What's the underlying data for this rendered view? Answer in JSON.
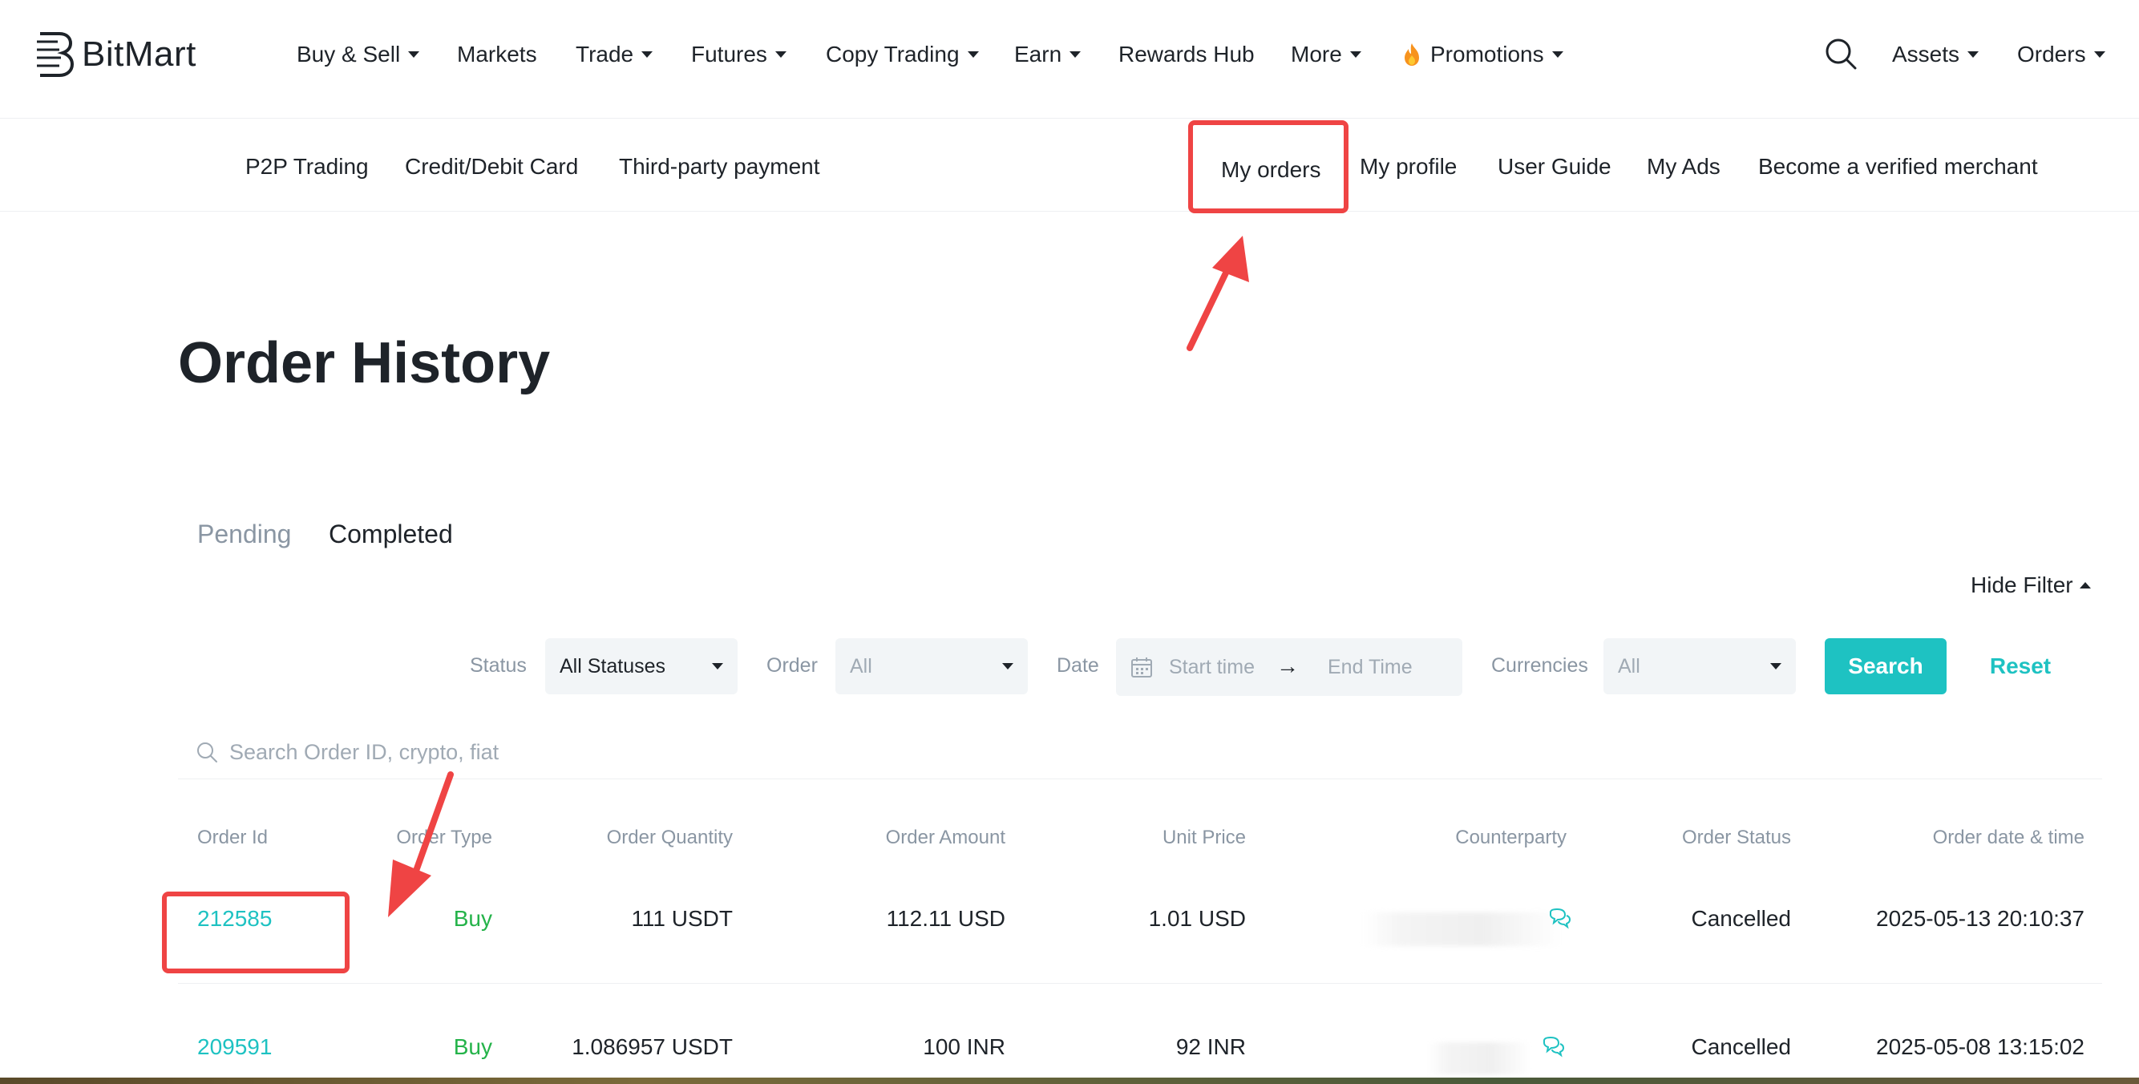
{
  "brand": {
    "name": "BitMart"
  },
  "topnav": {
    "items": [
      {
        "label": "Buy & Sell",
        "caret": true
      },
      {
        "label": "Markets",
        "caret": false
      },
      {
        "label": "Trade",
        "caret": true
      },
      {
        "label": "Futures",
        "caret": true
      },
      {
        "label": "Copy Trading",
        "caret": true
      },
      {
        "label": "Earn",
        "caret": true
      },
      {
        "label": "Rewards Hub",
        "caret": false
      },
      {
        "label": "More",
        "caret": true
      },
      {
        "label": "Promotions",
        "caret": true
      }
    ],
    "right": {
      "search_icon": "search-icon",
      "assets": "Assets",
      "orders": "Orders"
    }
  },
  "subnav": {
    "left": [
      "P2P Trading",
      "Credit/Debit Card",
      "Third-party payment"
    ],
    "right": [
      "My orders",
      "My profile",
      "User Guide",
      "My Ads",
      "Become a verified merchant"
    ]
  },
  "page": {
    "title": "Order History",
    "tabs": [
      "Pending",
      "Completed"
    ],
    "active_tab": "Completed",
    "hide_filter": "Hide Filter"
  },
  "filters": {
    "status_label": "Status",
    "status_value": "All Statuses",
    "order_label": "Order",
    "order_value": "All",
    "date_label": "Date",
    "date_start_placeholder": "Start time",
    "date_end_placeholder": "End Time",
    "currencies_label": "Currencies",
    "currencies_value": "All",
    "search_button": "Search",
    "reset_button": "Reset"
  },
  "order_search": {
    "placeholder": "Search Order ID, crypto, fiat"
  },
  "table": {
    "headers": [
      "Order Id",
      "Order Type",
      "Order Quantity",
      "Order Amount",
      "Unit Price",
      "Counterparty",
      "Order Status",
      "Order date & time"
    ],
    "rows": [
      {
        "order_id": "212585",
        "type": "Buy",
        "quantity": "111 USDT",
        "amount": "112.11 USD",
        "unit_price": "1.01 USD",
        "counterparty": "",
        "status": "Cancelled",
        "datetime": "2025-05-13 20:10:37"
      },
      {
        "order_id": "209591",
        "type": "Buy",
        "quantity": "1.086957 USDT",
        "amount": "100 INR",
        "unit_price": "92 INR",
        "counterparty": "",
        "status": "Cancelled",
        "datetime": "2025-05-08 13:15:02"
      }
    ]
  },
  "colors": {
    "accent": "#1ec2c2",
    "buy": "#25b34a",
    "annotation": "#ef4444",
    "muted": "#8a96a3"
  }
}
